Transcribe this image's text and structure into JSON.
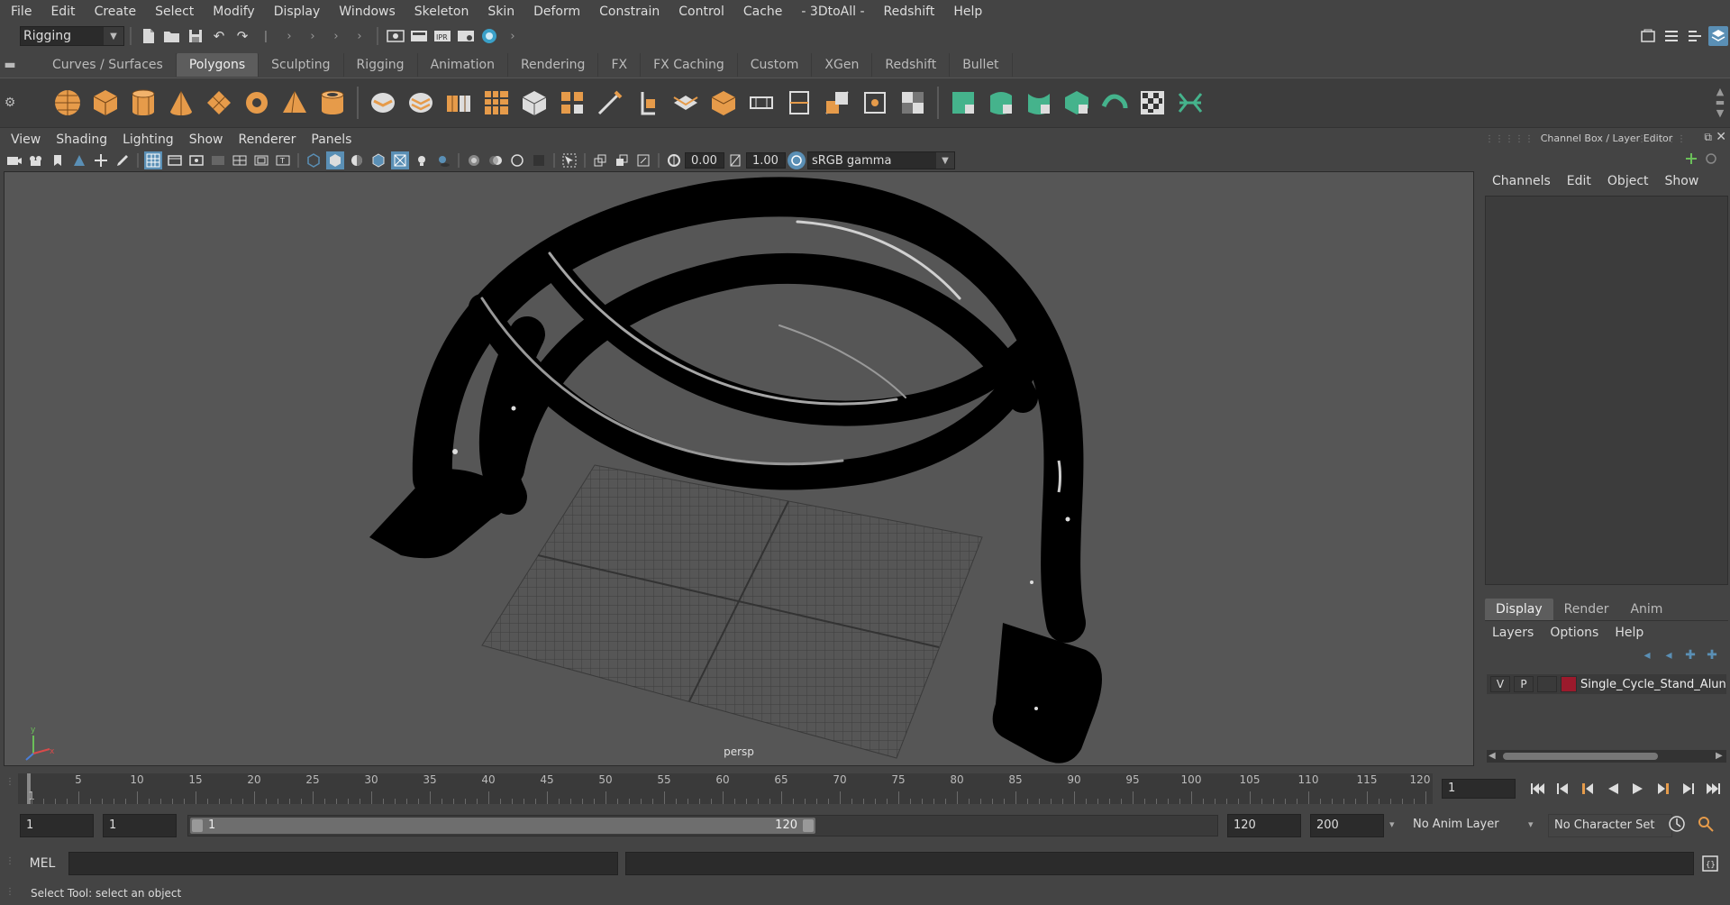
{
  "menubar": {
    "items": [
      "File",
      "Edit",
      "Create",
      "Select",
      "Modify",
      "Display",
      "Windows",
      "Skeleton",
      "Skin",
      "Deform",
      "Constrain",
      "Control",
      "Cache",
      "- 3DtoAll -",
      "Redshift",
      "Help"
    ]
  },
  "statusline": {
    "workspace_value": "Rigging"
  },
  "shelf": {
    "tabs": [
      "Curves / Surfaces",
      "Polygons",
      "Sculpting",
      "Rigging",
      "Animation",
      "Rendering",
      "FX",
      "FX Caching",
      "Custom",
      "XGen",
      "Redshift",
      "Bullet"
    ],
    "active_tab": "Polygons",
    "icons": [
      "poly-sphere-icon",
      "poly-cube-icon",
      "poly-cylinder-icon",
      "poly-cone-icon",
      "poly-plane-diamond-icon",
      "poly-torus-icon",
      "poly-pyramid-icon",
      "poly-pipe-icon",
      "combine-icon",
      "separate-icon",
      "extract-icon",
      "smooth-icon",
      "boolean-icon",
      "bevel-icon",
      "multi-cut-icon",
      "target-weld-icon",
      "mirror-icon",
      "bridge-icon",
      "extrude-icon",
      "insert-edge-loop-icon",
      "offset-edge-icon",
      "merge-icon",
      "uv-planar-icon",
      "uv-cylindrical-icon",
      "uv-spherical-icon",
      "uv-automatic-icon",
      "uv-editor-icon",
      "uv-layout-icon",
      "uv-checker-icon",
      "uv-unfold-icon"
    ]
  },
  "viewport": {
    "menu": [
      "View",
      "Shading",
      "Lighting",
      "Show",
      "Renderer",
      "Panels"
    ],
    "exposure": "0.00",
    "gamma": "1.00",
    "color_space": "sRGB gamma",
    "camera_label": "persp",
    "accent_color": "#5a8fb5"
  },
  "channel_box": {
    "title": "Channel Box / Layer Editor",
    "menu": [
      "Channels",
      "Edit",
      "Object",
      "Show"
    ]
  },
  "layer_editor": {
    "tabs": [
      "Display",
      "Render",
      "Anim"
    ],
    "active_tab": "Display",
    "menu": [
      "Layers",
      "Options",
      "Help"
    ],
    "layer": {
      "visible": "V",
      "playback": "P",
      "name": "Single_Cycle_Stand_Alun",
      "color": "#9b1a2c"
    }
  },
  "timeline": {
    "ticks": [
      "5",
      "10",
      "15",
      "20",
      "25",
      "30",
      "35",
      "40",
      "45",
      "50",
      "55",
      "60",
      "65",
      "70",
      "75",
      "80",
      "85",
      "90",
      "95",
      "100",
      "105",
      "110",
      "115",
      "120"
    ],
    "start_tick": "1",
    "current_frame": "1"
  },
  "range": {
    "start_frame": "1",
    "playback_start": "1",
    "slider_start": "1",
    "slider_end": "120",
    "playback_end": "120",
    "end_frame": "200",
    "anim_layer": "No Anim Layer",
    "character_set": "No Character Set"
  },
  "command_line": {
    "language": "MEL"
  },
  "help_line": {
    "text": "Select Tool: select an object"
  }
}
